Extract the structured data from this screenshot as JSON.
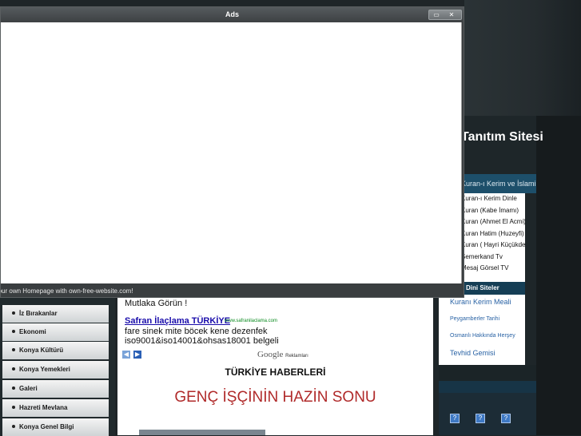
{
  "popup": {
    "title": "Ads",
    "status": "Your own Homepage with own-free-website.com!",
    "minimize_glyph": "▭",
    "close_glyph": "✕"
  },
  "site": {
    "title": "Tanıtım Sitesi"
  },
  "right_sidebar": {
    "box_heading": "Kuran-ı Kerim ve İslami TV",
    "items": [
      "Kuran-ı Kerim Dinle",
      "Kuran (Kabe İmamı)",
      "Kuran (Ahmet El Acmi)",
      "Kuran Hatim (Huzeyfi)",
      "Kuran ( Hayri Küçükdeniz)",
      "Semerkand Tv",
      "Mesaj Görsel TV"
    ],
    "links_heading": "Dini Siteler",
    "links": [
      "Kuranı Kerim Meali",
      "Peygamberler Tarihi",
      "Osmanlı Hakkında Herşey",
      "Tevhid Gemisi"
    ],
    "icon_glyph": "?"
  },
  "left_nav": {
    "items": [
      "İz Bırakanlar",
      "Ekonomi",
      "Konya Kültürü",
      "Konya Yemekleri",
      "Galeri",
      "Hazreti Mevlana",
      "Konya Genel Bilgi"
    ]
  },
  "ad": {
    "intro": "Mutlaka Görün !",
    "link_text": "Safran İlaçlama TÜRKİYE",
    "url": "www.safranilaclama.com",
    "desc_line1": "fare sinek mite böcek kene dezenfek",
    "desc_line2": "iso9001&iso14001&ohsas18001 belgeli",
    "prev_glyph": "◀",
    "next_glyph": "▶",
    "google_label": "Google",
    "google_sub": "Reklamları"
  },
  "main": {
    "section_title": "TÜRKİYE HABERLERİ",
    "headline": "GENÇ İŞÇİNİN HAZİN SONU"
  },
  "colors": {
    "headline": "#b02a2a",
    "link": "#1a0dab",
    "url": "#0a8a1f",
    "accent_blue": "#3e79c4"
  }
}
